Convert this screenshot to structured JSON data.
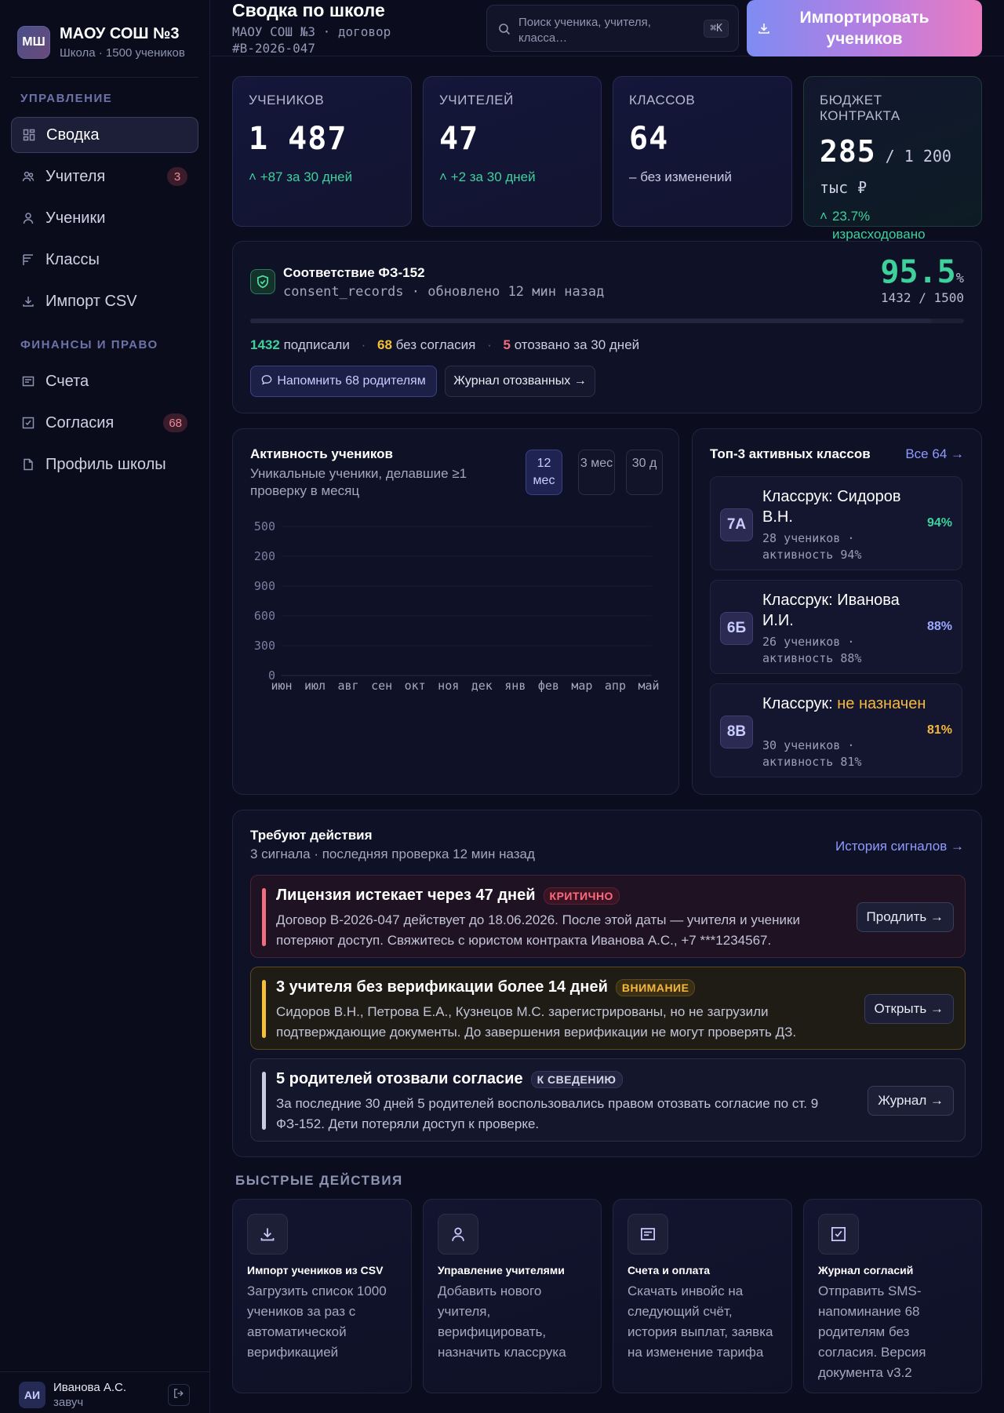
{
  "brand": {
    "logo": "МШ",
    "title": "МАОУ СОШ №3",
    "subtitle": "Школа · 1500 учеников"
  },
  "sidebar": {
    "section_manage": "УПРАВЛЕНИЕ",
    "section_finance": "ФИНАНСЫ И ПРАВО",
    "items": [
      {
        "label": "Сводка",
        "icon": "dashboard-icon",
        "active": true
      },
      {
        "label": "Учителя",
        "icon": "teachers-icon",
        "badge": "3"
      },
      {
        "label": "Ученики",
        "icon": "user-icon"
      },
      {
        "label": "Классы",
        "icon": "classes-icon"
      },
      {
        "label": "Импорт CSV",
        "icon": "download-icon"
      },
      {
        "label": "Счета",
        "icon": "invoice-icon"
      },
      {
        "label": "Согласия",
        "icon": "checkbox-icon",
        "badge": "68"
      },
      {
        "label": "Профиль школы",
        "icon": "file-icon"
      }
    ]
  },
  "user": {
    "initials": "АИ",
    "name": "Иванова А.С.",
    "role": "завуч"
  },
  "header": {
    "title": "Сводка по школе",
    "subtitle": "МАОУ СОШ №3 · договор #B-2026-047",
    "search_placeholder": "Поиск ученика, учителя, класса…",
    "search_shortcut": "⌘K",
    "import_label": "Импортировать учеников"
  },
  "stats": [
    {
      "label": "УЧЕНИКОВ",
      "value": "1 487",
      "delta": "+87 за 30 дней"
    },
    {
      "label": "УЧИТЕЛЕЙ",
      "value": "47",
      "delta": "+2 за 30 дней"
    },
    {
      "label": "КЛАССОВ",
      "value": "64",
      "delta": "без изменений"
    },
    {
      "label": "БЮДЖЕТ КОНТРАКТА",
      "value": "285",
      "value_suffix": " / 1 200 тыс ₽",
      "delta": "23.7% израсходовано"
    }
  ],
  "compliance": {
    "title": "Соответствие ФЗ-152",
    "subtitle": "consent_records · обновлено 12 мин назад",
    "percent": "95.5",
    "percent_unit": "%",
    "count": "1432 / 1500",
    "progress": 0.955,
    "signed": "1432",
    "signed_label": "подписали",
    "no_consent": "68",
    "no_consent_label": "без согласия",
    "revoked": "5",
    "revoked_label": "отозвано за 30 дней",
    "remind_label": "Напомнить 68 родителям",
    "journal_label": "Журнал отозванных →"
  },
  "activity": {
    "title": "Активность учеников",
    "subtitle": "Уникальные ученики, делавшие ≥1 проверку в месяц",
    "ranges": [
      "12 мес",
      "3 мес",
      "30 д"
    ]
  },
  "chart_data": {
    "type": "line",
    "title": "Активность учеников",
    "x": [
      "июн",
      "июл",
      "авг",
      "сен",
      "окт",
      "ноя",
      "дек",
      "янв",
      "фев",
      "мар",
      "апр",
      "май"
    ],
    "y_ticks": [
      "500",
      "200",
      "900",
      "600",
      "300",
      "0"
    ],
    "series": [],
    "grid": true
  },
  "top_classes": {
    "title": "Топ-3 активных классов",
    "link": "Все 64 →",
    "items": [
      {
        "badge": "7А",
        "prefix": "Классрук:",
        "teacher": "Сидоров В.Н.",
        "meta": "28 учеников · активность 94%",
        "pct": "94%",
        "color": "#3ed19b"
      },
      {
        "badge": "6Б",
        "prefix": "Классрук:",
        "teacher": "Иванова И.И.",
        "meta": "26 учеников · активность 88%",
        "pct": "88%",
        "color": "#9ba8ff"
      },
      {
        "badge": "8В",
        "prefix": "Классрук:",
        "teacher": "не назначен",
        "meta": "30 учеников · активность 81%",
        "pct": "81%",
        "color": "#f5b83d"
      }
    ]
  },
  "alerts": {
    "title": "Требуют действия",
    "subtitle": "3 сигнала · последняя проверка 12 мин назад",
    "link": "История сигналов →",
    "items": [
      {
        "title": "Лицензия истекает через 47 дней",
        "tag": "КРИТИЧНО",
        "text": "Договор B-2026-047 действует до 18.06.2026. После этой даты — учителя и ученики потеряют доступ. Свяжитесь с юристом контракта Иванова А.С., +7 ***1234567.",
        "action": "Продлить →",
        "color": "#f06e7e"
      },
      {
        "title": "3 учителя без верификации более 14 дней",
        "tag": "ВНИМАНИЕ",
        "text": "Сидоров В.Н., Петрова Е.А., Кузнецов М.С. зарегистрированы, но не загрузили подтверждающие документы. До завершения верификации не могут проверять ДЗ.",
        "action": "Открыть →",
        "color": "#f5c037"
      },
      {
        "title": "5 родителей отозвали согласие",
        "tag": "К СВЕДЕНИЮ",
        "text": "За последние 30 дней 5 родителей воспользовались правом отозвать согласие по ст. 9 ФЗ-152. Дети потеряли доступ к проверке.",
        "action": "Журнал →",
        "color": "#c9cbe0"
      }
    ]
  },
  "quick_actions": {
    "title": "БЫСТРЫЕ ДЕЙСТВИЯ",
    "items": [
      {
        "title": "Импорт учеников из CSV",
        "desc": "Загрузить список 1000 учеников за раз с автоматической верификацией",
        "icon": "download-icon"
      },
      {
        "title": "Управление учителями",
        "desc": "Добавить нового учителя, верифицировать, назначить классрука",
        "icon": "user-icon"
      },
      {
        "title": "Счета и оплата",
        "desc": "Скачать инвойс на следующий счёт, история выплат, заявка на изменение тарифа",
        "icon": "invoice-icon"
      },
      {
        "title": "Журнал согласий",
        "desc": "Отправить SMS-напоминание 68 родителям без согласия. Версия документа v3.2",
        "icon": "checkbox-icon"
      }
    ]
  }
}
